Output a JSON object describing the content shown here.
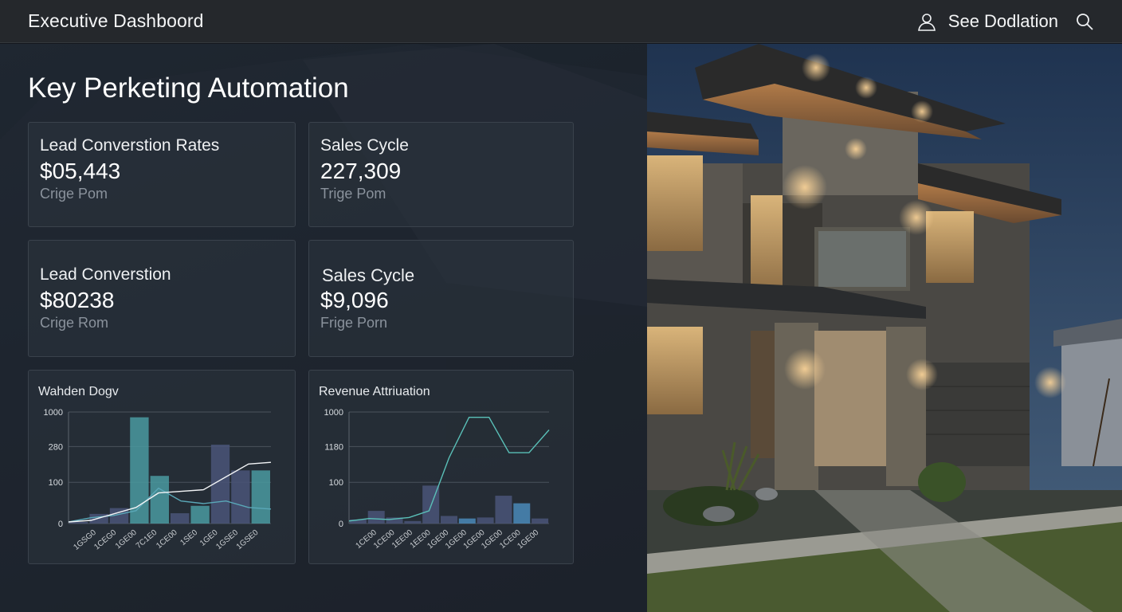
{
  "header": {
    "title": "Executive Dashboord",
    "user_label": "See Dodlation",
    "user_icon": "user-icon",
    "search_icon": "search-icon"
  },
  "main": {
    "section_title": "Key Perketing Automation",
    "kpis": [
      {
        "label": "Lead Converstion Rates",
        "value": "$05,443",
        "sub": "Crige Pom"
      },
      {
        "label": "Sales Cycle",
        "value": "227,309",
        "sub": "Trige Pom"
      },
      {
        "label": "Lead Converstion",
        "value": "$80238",
        "sub": "Crige Rom"
      },
      {
        "label": "Sales Cycle",
        "value": "$9,096",
        "sub": "Frige Porn"
      }
    ]
  },
  "chart_data": [
    {
      "type": "bar",
      "title": "Wahden Dogv",
      "ytick_labels": [
        "1000",
        "280",
        "100",
        "0"
      ],
      "xtick_labels": [
        "1GSG0",
        "1CEG0",
        "1GE00",
        "7C1E0",
        "1CE00",
        "1SE0",
        "1GE0",
        "1GSE0",
        "1GSE0"
      ],
      "colors": {
        "bars_dark": "#4a5578",
        "bars_teal": "#4a9aa0",
        "line": "#f2f4f6",
        "line2": "#5aa8b8"
      },
      "series": [
        {
          "values": [
            5,
            30,
            48,
            330,
            148,
            32,
            55,
            245,
            165,
            165
          ]
        },
        {
          "values": [
            5,
            18,
            25,
            40,
            110,
            70,
            62,
            70,
            50,
            45
          ]
        },
        {
          "values": [
            5,
            10,
            30,
            50,
            95,
            100,
            105,
            145,
            185,
            190
          ]
        }
      ]
    },
    {
      "type": "bar",
      "title": "Revenue Attriuation",
      "ytick_labels": [
        "1000",
        "1180",
        "100",
        "0"
      ],
      "xtick_labels": [
        "1CE00",
        "1CE00",
        "1EE00",
        "1EE00",
        "1GE00",
        "1GE00",
        "1GE00",
        "1GE00",
        "1CE00",
        "1GE00"
      ],
      "colors": {
        "bars_dark": "#4a5578",
        "bars_teal": "#4a8ab8",
        "line": "#5ac0b8"
      },
      "series": [
        {
          "values": [
            8,
            25,
            12,
            5,
            75,
            15,
            10,
            12,
            55,
            40,
            10
          ]
        },
        {
          "values": [
            5,
            10,
            8,
            12,
            25,
            130,
            210,
            210,
            140,
            140,
            185
          ]
        }
      ]
    }
  ]
}
